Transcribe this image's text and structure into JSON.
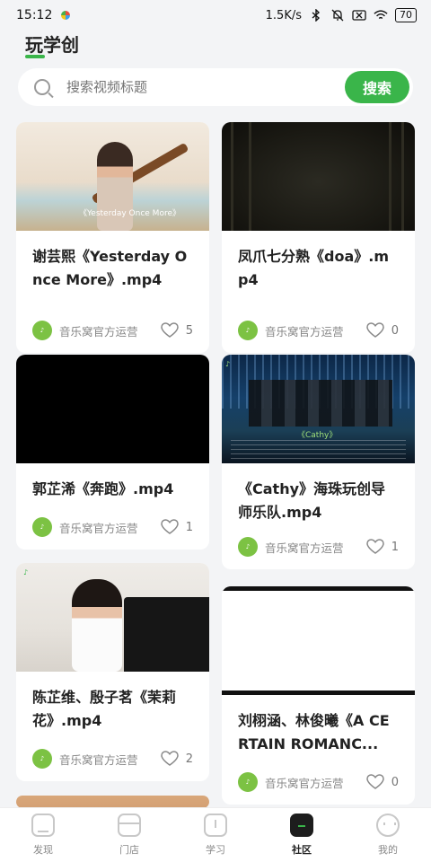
{
  "status_bar": {
    "time": "15:12",
    "network_speed": "1.5K/s",
    "battery": "70",
    "icons": [
      "colorful-dot-icon",
      "bluetooth-icon",
      "mute-icon",
      "sim-off-icon",
      "wifi-icon",
      "battery-icon"
    ]
  },
  "header": {
    "title": "玩学创"
  },
  "search": {
    "placeholder": "搜索视频标题",
    "button_label": "搜索"
  },
  "cards": [
    {
      "title": "谢芸熙《Yesterday Once More》.mp4",
      "author": "音乐窝官方运营",
      "likes": "5",
      "thumb_caption": "《Yesterday Once More》"
    },
    {
      "title": "凤爪七分熟《doa》.mp4",
      "author": "音乐窝官方运营",
      "likes": "0"
    },
    {
      "title": "郭芷浠《奔跑》.mp4",
      "author": "音乐窝官方运营",
      "likes": "1"
    },
    {
      "title": "《Cathy》海珠玩创导师乐队.mp4",
      "author": "音乐窝官方运营",
      "likes": "1",
      "thumb_caption": "《Cathy》"
    },
    {
      "title": "陈芷维、殷子茗《茉莉花》.mp4",
      "author": "音乐窝官方运营",
      "likes": "2"
    },
    {
      "title": "刘栩涵、林俊曦《A CERTAIN ROMANC...",
      "author": "音乐窝官方运营",
      "likes": "0"
    }
  ],
  "bottom_nav": [
    {
      "label": "发现",
      "icon": "home-icon",
      "active": false
    },
    {
      "label": "门店",
      "icon": "store-icon",
      "active": false
    },
    {
      "label": "学习",
      "icon": "book-icon",
      "active": false
    },
    {
      "label": "社区",
      "icon": "community-icon",
      "active": true
    },
    {
      "label": "我的",
      "icon": "profile-icon",
      "active": false
    }
  ],
  "colors": {
    "accent": "#3ab54a",
    "background": "#f3f4f6"
  }
}
